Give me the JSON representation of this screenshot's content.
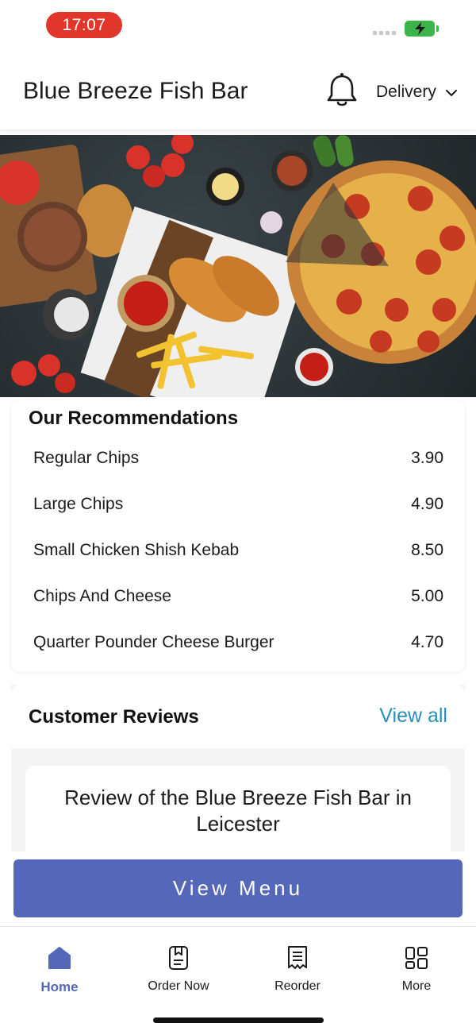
{
  "status_bar": {
    "time": "17:07"
  },
  "header": {
    "restaurant_name": "Blue Breeze Fish Bar",
    "delivery_label": "Delivery"
  },
  "recommendations": {
    "title": "Our Recommendations",
    "items": [
      {
        "name": "Regular Chips",
        "price": "3.90"
      },
      {
        "name": "Large Chips",
        "price": "4.90"
      },
      {
        "name": "Small Chicken Shish Kebab",
        "price": "8.50"
      },
      {
        "name": "Chips And Cheese",
        "price": "5.00"
      },
      {
        "name": "Quarter Pounder Cheese Burger",
        "price": "4.70"
      }
    ]
  },
  "reviews": {
    "title": "Customer Reviews",
    "view_all": "View all",
    "card_title": "Review of the Blue Breeze Fish Bar in Leicester"
  },
  "view_menu_label": "View Menu",
  "bottom_nav": {
    "items": [
      {
        "label": "Home",
        "icon": "home-icon",
        "active": true
      },
      {
        "label": "Order Now",
        "icon": "order-icon",
        "active": false
      },
      {
        "label": "Reorder",
        "icon": "receipt-icon",
        "active": false
      },
      {
        "label": "More",
        "icon": "grid-icon",
        "active": false
      }
    ]
  },
  "colors": {
    "accent": "#5567b8",
    "link": "#2a8fb8",
    "time_pill": "#e0362c",
    "battery": "#3bb54a"
  }
}
